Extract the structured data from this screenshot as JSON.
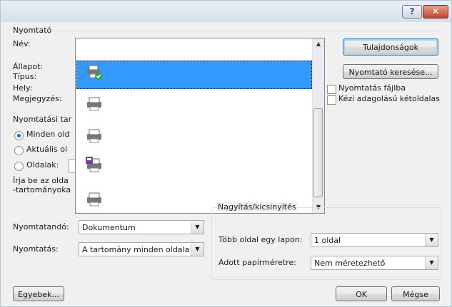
{
  "window": {
    "help_glyph": "?",
    "close_glyph": "✕"
  },
  "printer_group": {
    "title": "Nyomtató",
    "name_label": "Név:",
    "status_label": "Állapot:",
    "type_label": "Típus:",
    "where_label": "Hely:",
    "comment_label": "Megjegyzés:",
    "properties_button": "Tulajdonságok",
    "find_printer_button": "Nyomtató keresése...",
    "print_to_file": "Nyomtatás fájlba",
    "manual_duplex": "Kézi adagolású kétoldalas"
  },
  "printer_dropdown": {
    "selected_index": 1,
    "item_icons": [
      "printer-network-icon",
      "printer-network-ok-icon",
      "printer-icon",
      "printer-icon",
      "printer-fax-icon",
      "printer-icon"
    ]
  },
  "range_group": {
    "title": "Nyomtatási tar",
    "all": "Minden old",
    "current": "Aktuális ol",
    "pages": "Oldalak:",
    "hint_line1": "Írja be az olda",
    "hint_line2": "-tartományoka"
  },
  "zoom_group": {
    "title": "Nagyítás/kicsinyítés",
    "pages_per_sheet_label": "Több oldal egy lapon:",
    "pages_per_sheet_value": "1 oldal",
    "scale_label": "Adott papírméretre:",
    "scale_value": "Nem méretezhető"
  },
  "bottom": {
    "print_what_label": "Nyomtatandó:",
    "print_what_value": "Dokumentum",
    "print_label": "Nyomtatás:",
    "print_value": "A tartomány minden oldala",
    "options_button": "Egyebek...",
    "ok_button": "OK",
    "cancel_button": "Mégse"
  }
}
